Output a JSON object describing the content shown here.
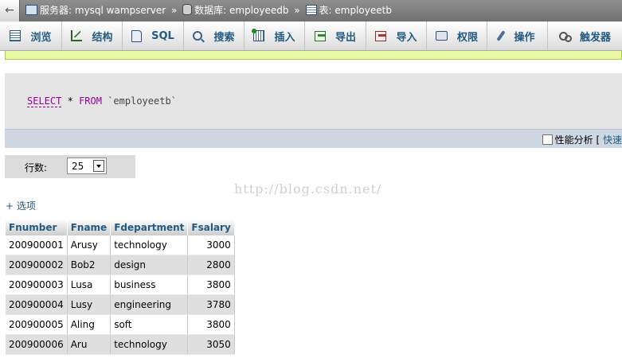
{
  "breadcrumb": {
    "server_label": "服务器:",
    "server_value": "mysql wampserver",
    "database_label": "数据库:",
    "database_value": "employeedb",
    "table_label": "表:",
    "table_value": "employeetb",
    "separator": "»"
  },
  "tabs": [
    {
      "label": "浏览",
      "icon": "browse-icon"
    },
    {
      "label": "结构",
      "icon": "structure-icon"
    },
    {
      "label": "SQL",
      "icon": "sql-icon"
    },
    {
      "label": "搜索",
      "icon": "search-icon"
    },
    {
      "label": "插入",
      "icon": "insert-icon"
    },
    {
      "label": "导出",
      "icon": "export-icon"
    },
    {
      "label": "导入",
      "icon": "import-icon"
    },
    {
      "label": "权限",
      "icon": "privileges-icon"
    },
    {
      "label": "操作",
      "icon": "operations-icon"
    },
    {
      "label": "触发器",
      "icon": "triggers-icon"
    }
  ],
  "sql": {
    "keyword_select": "SELECT",
    "star": "*",
    "keyword_from": "FROM",
    "table": "`employeetb`"
  },
  "profiling": {
    "label": "性能分析",
    "bracket": "[",
    "quick_link": "快速"
  },
  "rows_control": {
    "label": "行数:",
    "value": "25"
  },
  "watermark": "http://blog.csdn.net/",
  "options_link": "+ 选项",
  "table": {
    "columns": [
      "Fnumber",
      "Fname",
      "Fdepartment",
      "Fsalary"
    ],
    "rows": [
      [
        "200900001",
        "Arusy",
        "technology",
        "3000"
      ],
      [
        "200900002",
        "Bob2",
        "design",
        "2800"
      ],
      [
        "200900003",
        "Lusa",
        "business",
        "3800"
      ],
      [
        "200900004",
        "Lusy",
        "engineering",
        "3780"
      ],
      [
        "200900005",
        "Aling",
        "soft",
        "3800"
      ],
      [
        "200900006",
        "Aru",
        "technology",
        "3050"
      ]
    ]
  },
  "colors": {
    "accent": "#235a81",
    "sql_keyword": "#990099",
    "message_bg": "#ebf8a4"
  }
}
